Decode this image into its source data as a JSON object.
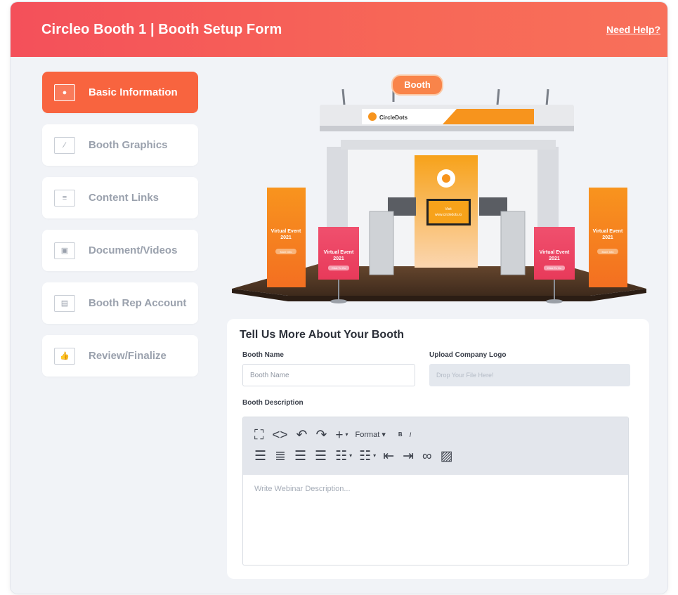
{
  "header": {
    "title": "Circleo Booth 1 | Booth Setup Form",
    "help_link": "Need Help?"
  },
  "sidebar": {
    "items": [
      {
        "label": "Basic Information",
        "icon": "info-card-icon",
        "active": true
      },
      {
        "label": "Booth Graphics",
        "icon": "graphics-icon",
        "active": false
      },
      {
        "label": "Content Links",
        "icon": "links-icon",
        "active": false
      },
      {
        "label": "Document/Videos",
        "icon": "video-doc-icon",
        "active": false
      },
      {
        "label": "Booth Rep Account",
        "icon": "rep-account-icon",
        "active": false
      },
      {
        "label": "Review/Finalize",
        "icon": "thumbs-up-icon",
        "active": false
      }
    ]
  },
  "booth_preview": {
    "sign": "Booth",
    "brand": "CircleDots",
    "screen_line1": "Visit",
    "screen_line2": "www.circledots.io",
    "banner_title": "Virtual Event",
    "banner_year": "2021",
    "banner_button": "Click To Go",
    "banner_more": "More Info"
  },
  "form": {
    "heading": "Tell Us More About Your Booth",
    "booth_name_label": "Booth Name",
    "booth_name_placeholder": "Booth Name",
    "logo_label": "Upload Company Logo",
    "logo_drop_text": "Drop Your File Here!",
    "description_label": "Booth Description",
    "format_label": "Format",
    "bold_label": "B",
    "italic_label": "I",
    "description_placeholder": "Write Webinar Description..."
  },
  "colors": {
    "header_start": "#f4505a",
    "header_end": "#f8705a",
    "active_nav": "#f8643f",
    "brand_orange": "#f7a21a"
  }
}
